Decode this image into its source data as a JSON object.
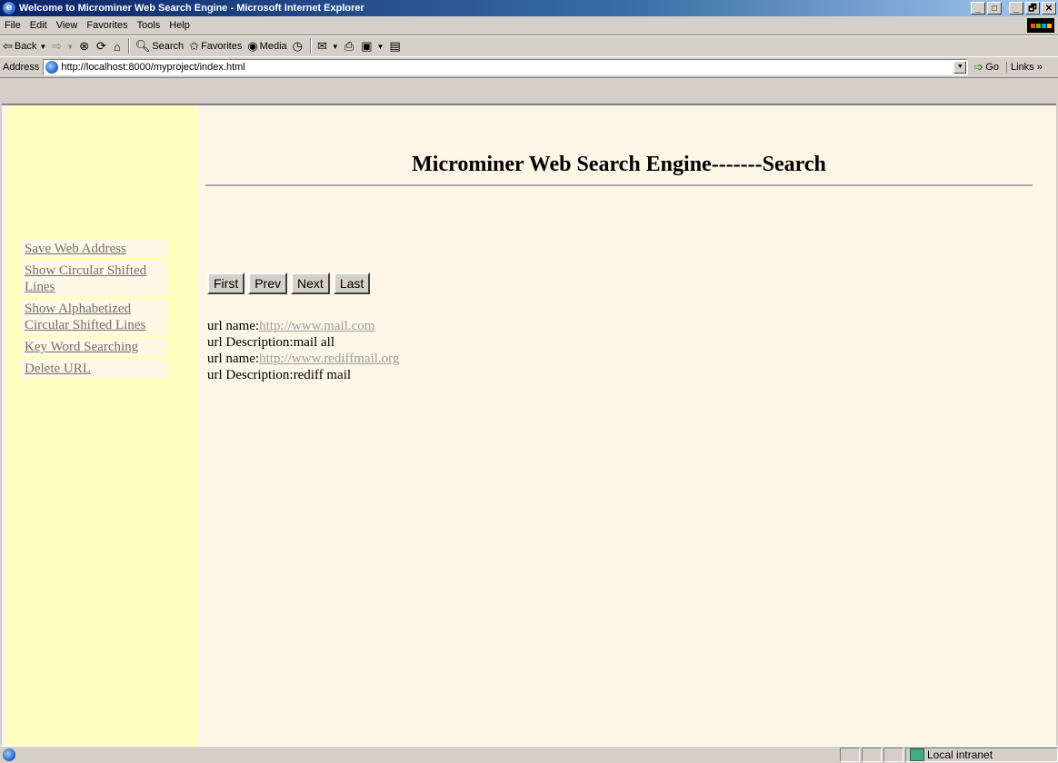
{
  "window": {
    "title": "Welcome to Microminer Web Search Engine - Microsoft Internet Explorer",
    "buttons": [
      "_",
      "□",
      "_",
      "🗗",
      "✕"
    ]
  },
  "menu": [
    "File",
    "Edit",
    "View",
    "Favorites",
    "Tools",
    "Help"
  ],
  "toolbar": {
    "back": "Back",
    "search": "Search",
    "favorites": "Favorites",
    "media": "Media"
  },
  "address": {
    "label": "Address",
    "url": "http://localhost:8000/myproject/index.html",
    "go": "Go",
    "links": "Links »"
  },
  "page": {
    "title": "Microminer Web Search Engine-------Search",
    "nav": [
      "Save Web Address",
      "Show Circular Shifted Lines",
      "Show Alphabetized Circular Shifted Lines",
      "Key Word Searching",
      "Delete URL"
    ],
    "pager": [
      "First",
      "Prev",
      "Next",
      "Last"
    ],
    "results": [
      {
        "name_label": "url name:",
        "url": "http://www.mail.com",
        "desc_label": "url Description:",
        "desc": "mail all"
      },
      {
        "name_label": "url name:",
        "url": "http://www.rediffmail.org",
        "desc_label": "url Description:",
        "desc": "rediff mail"
      }
    ]
  },
  "status": {
    "zone": "Local intranet"
  }
}
